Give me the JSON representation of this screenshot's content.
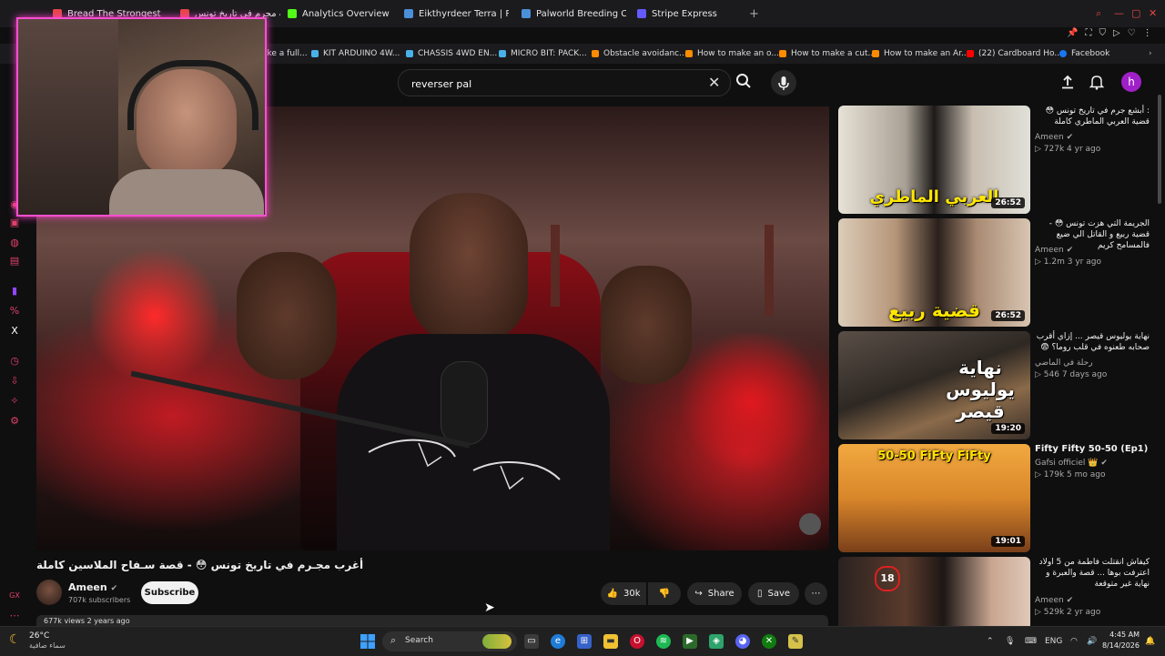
{
  "browser": {
    "tabs": [
      {
        "label": "Bread The Strongest Pals",
        "color": "#e64545"
      },
      {
        "label": "أغرب مجرم في تاريخ تونس",
        "color": "#e64545"
      },
      {
        "label": "Analytics Overview - Kick",
        "color": "#53fc18"
      },
      {
        "label": "Eikthyrdeer Terra | Palworld",
        "color": "#4a90d9"
      },
      {
        "label": "Palworld Breeding Calculator",
        "color": "#4a90d9"
      },
      {
        "label": "Stripe Express",
        "color": "#635bff"
      }
    ],
    "new_tab": "+",
    "bookmarks": [
      {
        "label": "ake a full...",
        "color": "#ff6d00"
      },
      {
        "label": "KIT ARDUINO 4W...",
        "color": "#4ab0e8"
      },
      {
        "label": "CHASSIS 4WD EN...",
        "color": "#4ab0e8"
      },
      {
        "label": "MICRO BIT: PACK...",
        "color": "#4ab0e8"
      },
      {
        "label": "Obstacle avoidanc...",
        "color": "#ff8c00"
      },
      {
        "label": "How to make an o...",
        "color": "#ff8c00"
      },
      {
        "label": "How to make a cut...",
        "color": "#ff8c00"
      },
      {
        "label": "How to make an Ar...",
        "color": "#ff8c00"
      },
      {
        "label": "(22) Cardboard Ho...",
        "color": "#ff0000"
      },
      {
        "label": "Facebook",
        "color": "#1877f2"
      }
    ]
  },
  "youtube": {
    "search": {
      "value": "reverser pal",
      "placeholder": "Search"
    },
    "avatar_letter": "h",
    "video": {
      "title": "أغرب مجـرم في تاريخ تونس 😳 - قصة سـفاح الملاسين كاملة",
      "channel": "Ameen",
      "subscribers": "707k subscribers",
      "subscribe_label": "Subscribe",
      "likes": "30k",
      "share_label": "Share",
      "save_label": "Save",
      "views_partial": "677k views  2 years ago"
    },
    "recommended": [
      {
        "title": ": أبشع جرم في تاريخ تونس 😳 قضية العربي الماطري كاملة",
        "channel": "Ameen",
        "meta": "727k  4 yr ago",
        "duration": "26:52",
        "thumb_text": "العربي الماطري"
      },
      {
        "title": "الجريمة التي هزت تونس 😳 - قضية ربيع و القاتل الي ضيع فالمسامح كريم",
        "channel": "Ameen",
        "meta": "1.2m  3 yr ago",
        "duration": "26:52",
        "thumb_text": "قضية ربيع"
      },
      {
        "title": "نهاية يوليوس قيصر ... إزاي أقرب صحابه طعنوه في قلب روما؟ 😨",
        "channel": "رحلة في الماضي",
        "meta": "546  7 days ago",
        "duration": "19:20",
        "thumb_text": "نهاية يوليوس قيصر"
      },
      {
        "title": "Fifty Fifty 50-50 (Ep1)",
        "channel": "Gafsi officiel 👑",
        "meta": "179k  5 mo ago",
        "duration": "19:01",
        "thumb_text": "50-50 FiFty FiFty"
      },
      {
        "title": "كيفاش انقتلت فاطمة من 5 اولاد اعترفت بوها ... قصة والعبرة و نهاية غير متوقعة",
        "channel": "Ameen",
        "meta": "529k  2 yr ago",
        "duration": "",
        "thumb_text": ""
      }
    ]
  },
  "taskbar": {
    "weather_temp": "26°C",
    "weather_desc": "سماء صافية",
    "search_label": "Search",
    "language": "ENG",
    "time": "4:45 AM",
    "date": "8/14/2026"
  },
  "colors": {
    "webcam_border": "#ff4fd0",
    "youtube_red": "#ff0000",
    "avatar": "#a020c8",
    "sidebar_icons": "#e0406d"
  }
}
